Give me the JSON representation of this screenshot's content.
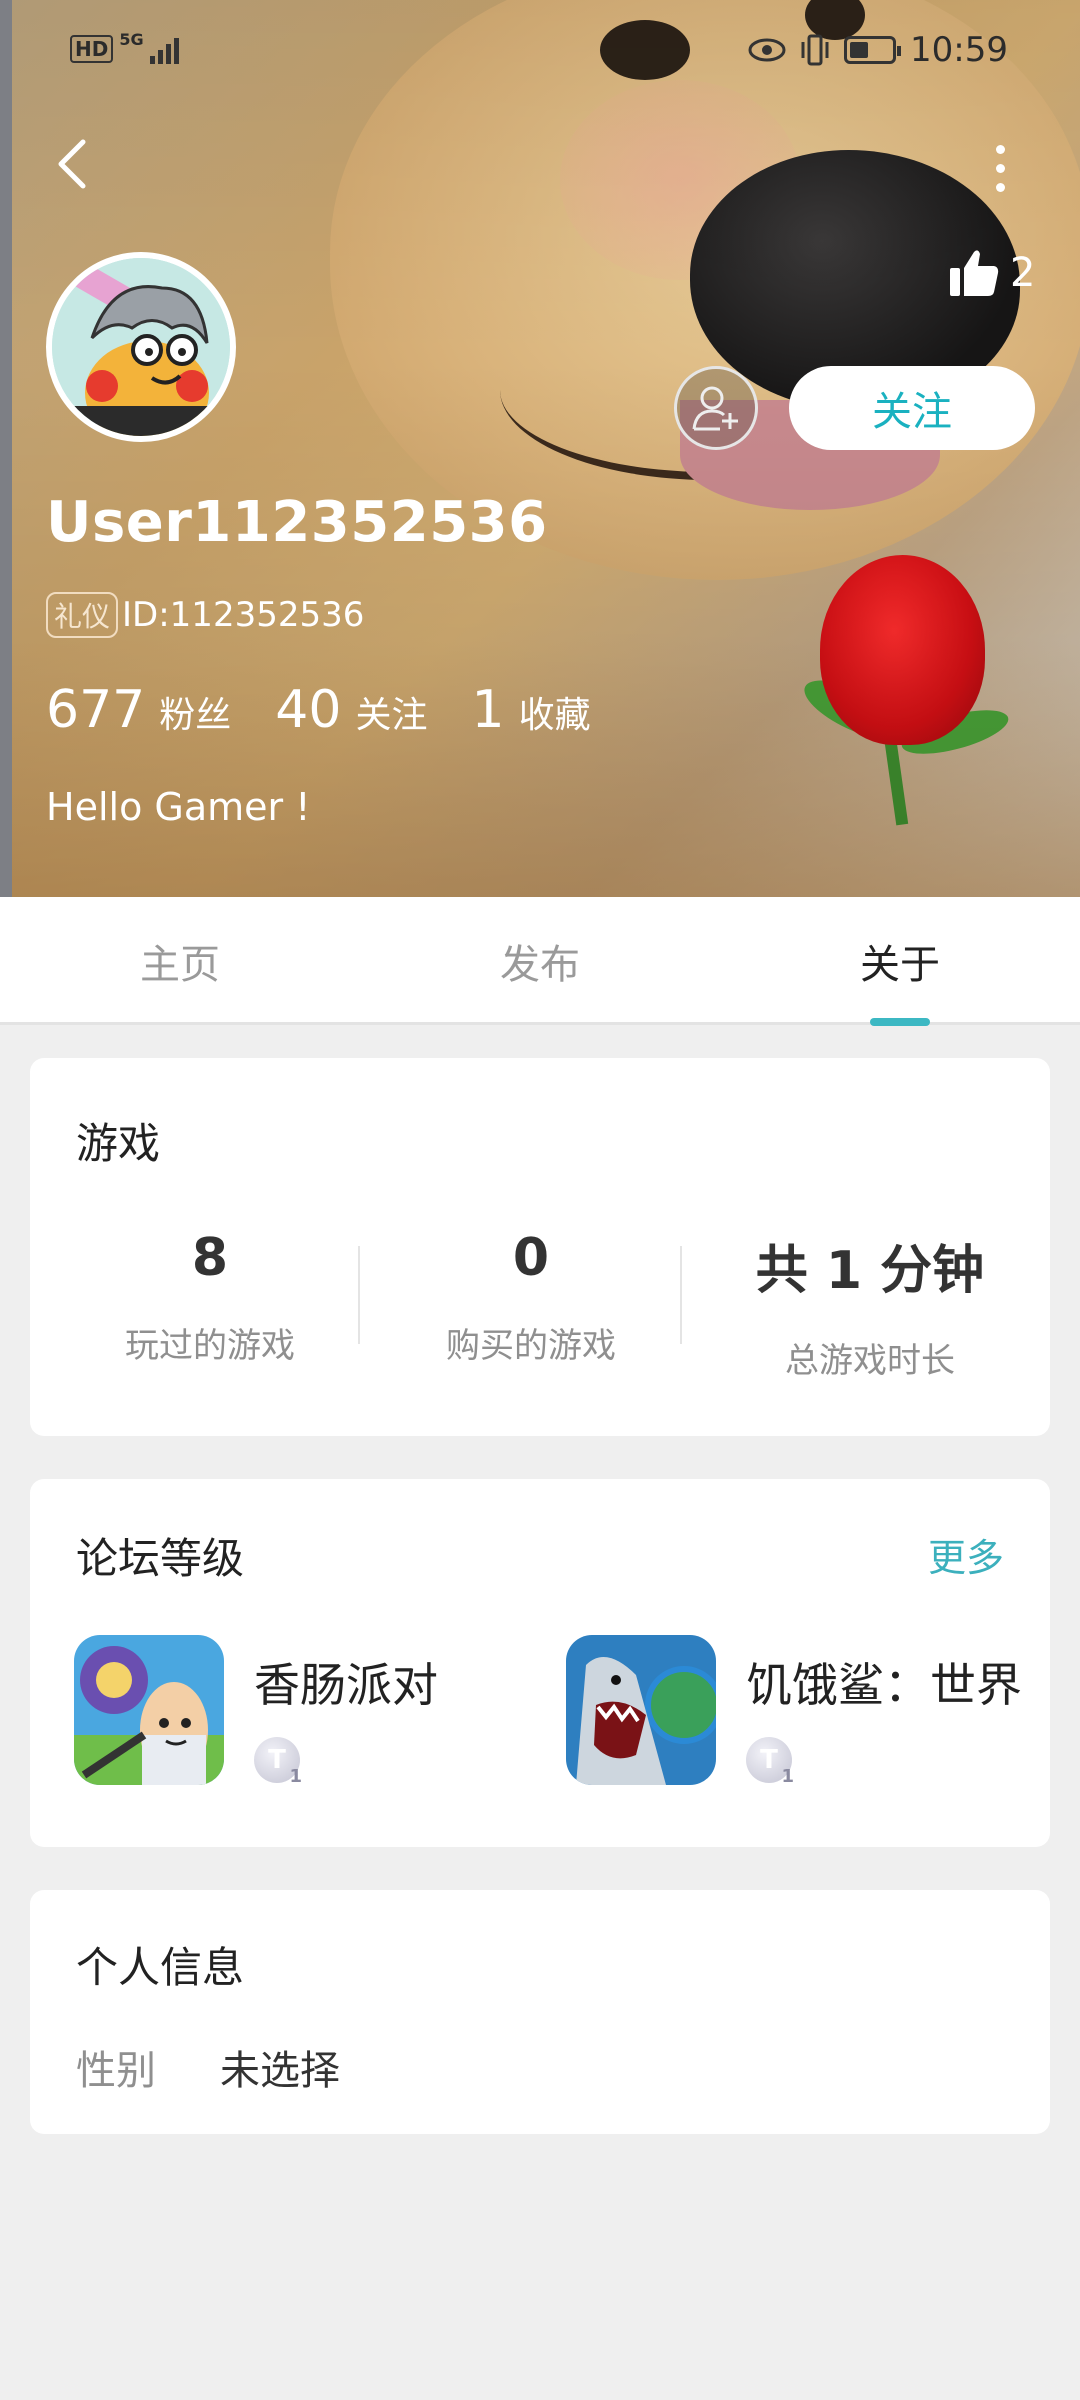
{
  "status_bar": {
    "hd_label": "HD",
    "network_label": "5G",
    "time": "10:59"
  },
  "profile": {
    "like_count": "2",
    "follow_label": "关注",
    "username": "User112352536",
    "badge_label": "礼仪",
    "id_text": "ID:112352536",
    "stats": [
      {
        "value": "677",
        "label": "粉丝"
      },
      {
        "value": "40",
        "label": "关注"
      },
      {
        "value": "1",
        "label": "收藏"
      }
    ],
    "bio": "Hello Gamer !"
  },
  "tabs": [
    {
      "label": "主页",
      "active": false
    },
    {
      "label": "发布",
      "active": false
    },
    {
      "label": "关于",
      "active": true
    }
  ],
  "games_card": {
    "title": "游戏",
    "stats": [
      {
        "value": "8",
        "label": "玩过的游戏"
      },
      {
        "value": "0",
        "label": "购买的游戏"
      },
      {
        "value": "共 1 分钟",
        "label": "总游戏时长"
      }
    ]
  },
  "forum_card": {
    "title": "论坛等级",
    "more_label": "更多",
    "items": [
      {
        "name": "香肠派对",
        "level_letter": "T",
        "level_num": "1"
      },
      {
        "name": "饥饿鲨：世界",
        "level_letter": "T",
        "level_num": "1"
      }
    ]
  },
  "info_card": {
    "title": "个人信息",
    "gender_key": "性别",
    "gender_value": "未选择"
  },
  "colors": {
    "accent": "#3cb8c3",
    "follow_text": "#1ab1c0",
    "page_bg": "#efefef"
  }
}
